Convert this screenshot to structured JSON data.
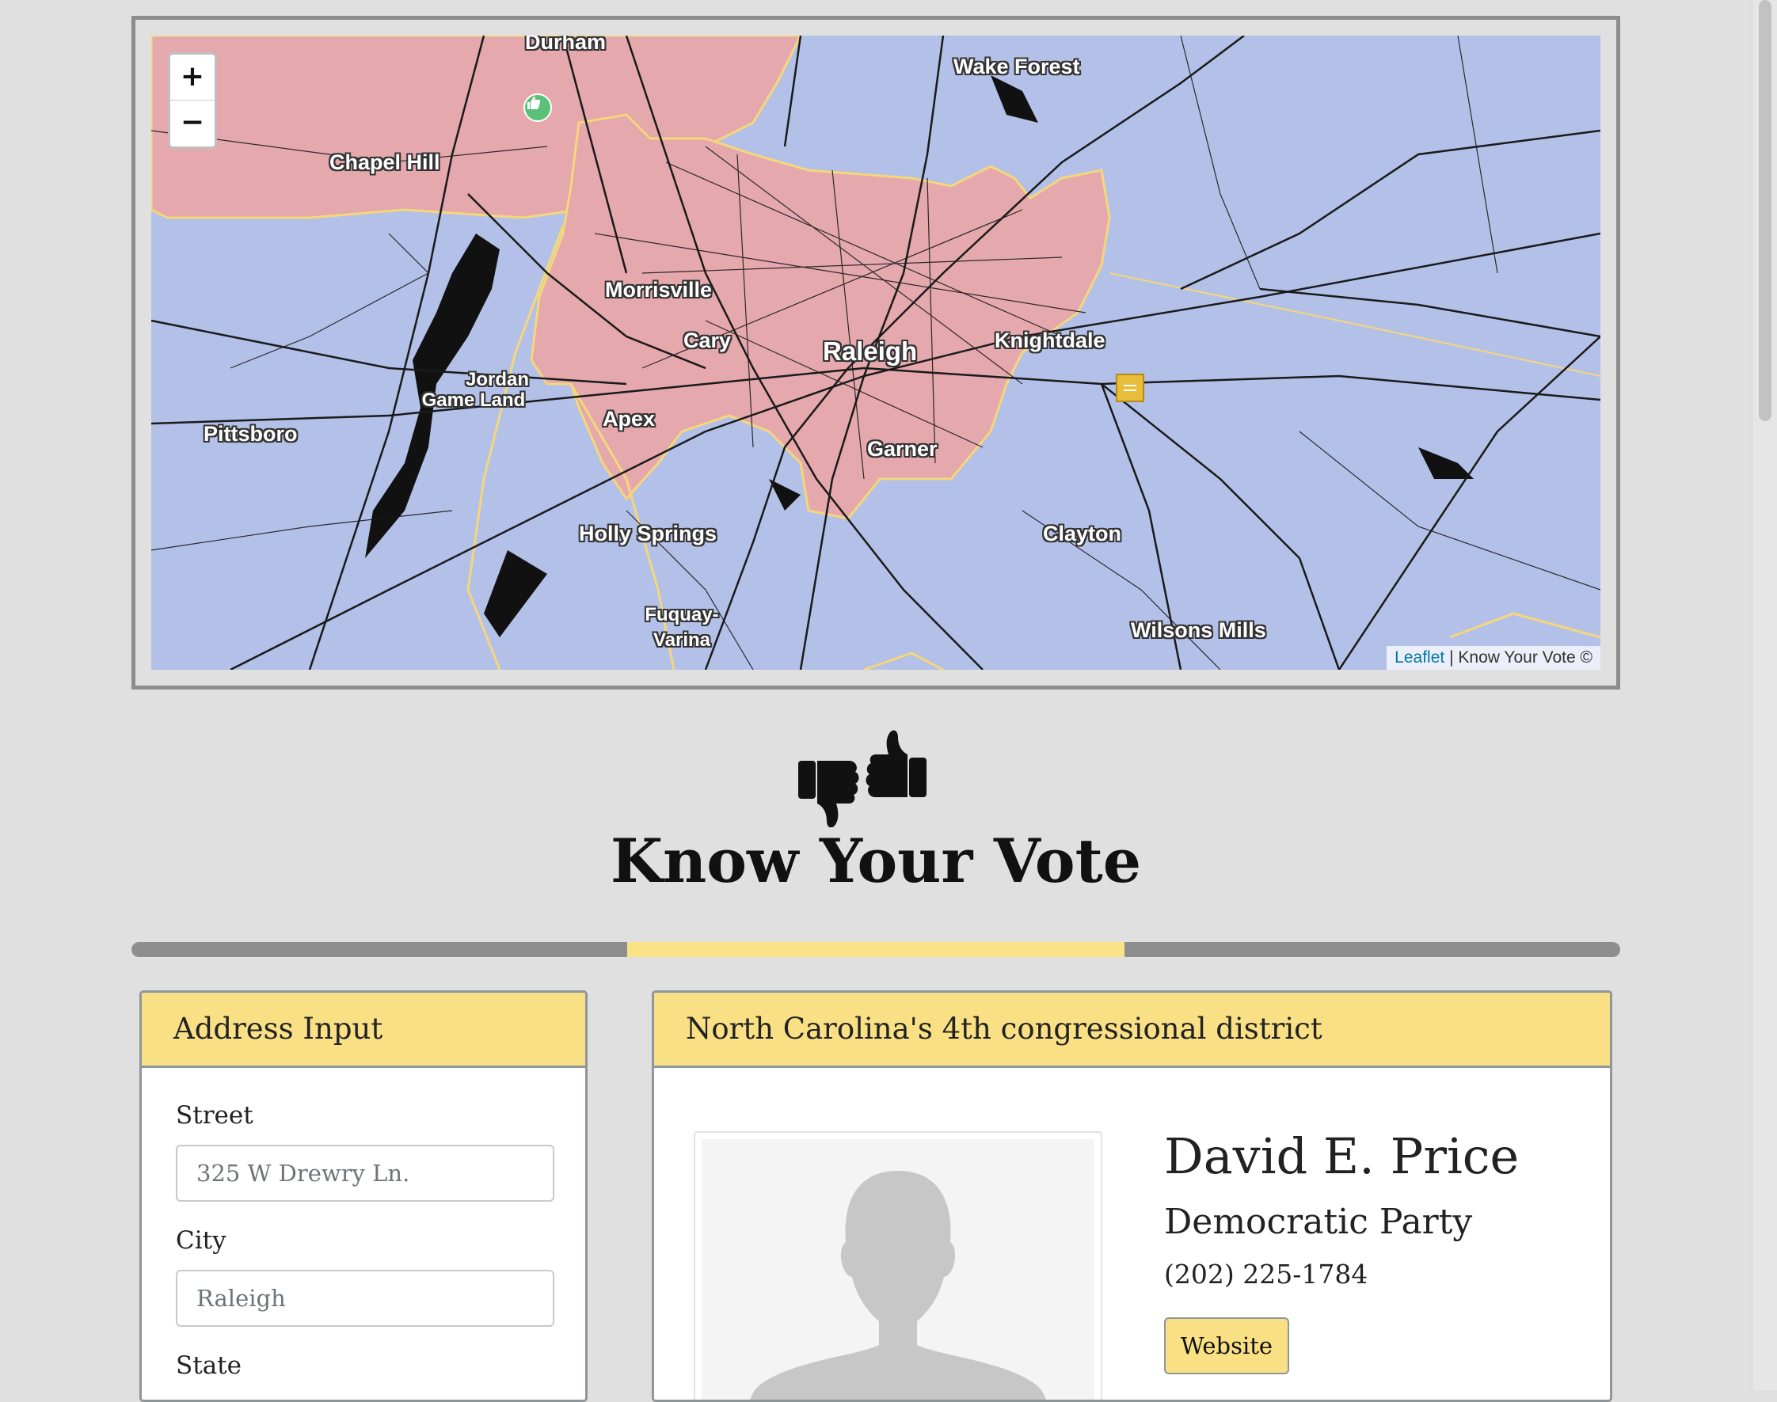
{
  "map": {
    "zoom_in_label": "+",
    "zoom_out_label": "−",
    "attribution_link": "Leaflet",
    "attribution_sep": "|",
    "attribution_text": "Know Your Vote ©",
    "colors": {
      "water": "#b3c0e8",
      "district": "#e4a8ad",
      "boundary": "#f5d77a",
      "roads": "#1a1a1a"
    },
    "towns": {
      "durham": "Durham",
      "wake_forest": "Wake Forest",
      "chapel_hill": "Chapel Hill",
      "morrisville": "Morrisville",
      "cary": "Cary",
      "raleigh": "Raleigh",
      "knightdale": "Knightdale",
      "jordan_1": "Jordan",
      "jordan_2": "Game Land",
      "pittsboro": "Pittsboro",
      "apex": "Apex",
      "garner": "Garner",
      "holly_springs": "Holly Springs",
      "clayton": "Clayton",
      "fuquay_1": "Fuquay-",
      "fuquay_2": "Varina",
      "wilsons_mills": "Wilsons Mills"
    },
    "markers": [
      "thumbs-up-marker-icon",
      "flag-marker-icon"
    ]
  },
  "header": {
    "logo_icon": "thumbs-down-thumbs-up-icon",
    "title": "Know Your Vote"
  },
  "progress": {
    "fraction_start": 0.333,
    "fraction_end": 0.667,
    "color": "#fae286"
  },
  "address": {
    "heading": "Address Input",
    "street_label": "Street",
    "street_placeholder": "325 W Drewry Ln.",
    "city_label": "City",
    "city_placeholder": "Raleigh",
    "state_label": "State"
  },
  "district": {
    "heading": "North Carolina's 4th congressional district",
    "rep_name": "David E. Price",
    "rep_party": "Democratic Party",
    "rep_phone": "(202) 225-1784",
    "website_label": "Website",
    "photo_icon": "person-silhouette-icon"
  }
}
